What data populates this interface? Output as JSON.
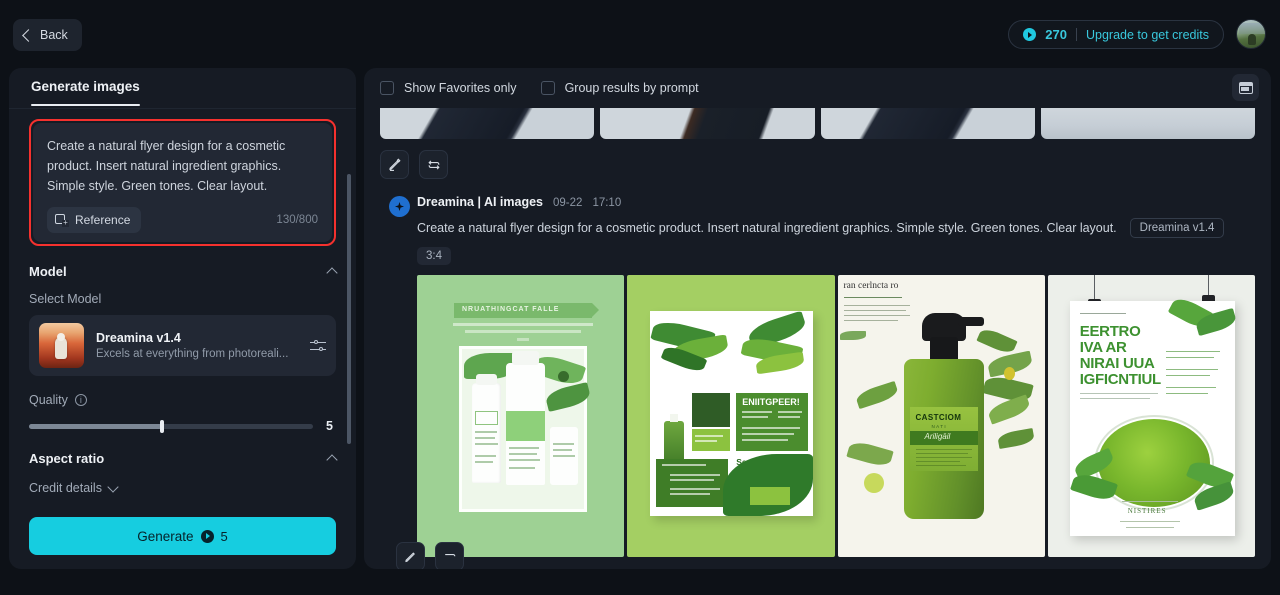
{
  "topbar": {
    "back_label": "Back",
    "credits_value": "270",
    "upgrade_label": "Upgrade to get credits",
    "coin_icon": "credit-coin-icon",
    "avatar_icon": "user-avatar"
  },
  "sidebar": {
    "tab_label": "Generate images",
    "prompt": {
      "text": "Create a natural flyer design for a cosmetic product. Insert natural ingredient graphics. Simple style. Green tones. Clear layout.",
      "reference_label": "Reference",
      "reference_icon": "add-image-icon",
      "char_count": "130/800"
    },
    "model_section": {
      "title": "Model",
      "collapse_icon": "chevron-up-icon",
      "select_label": "Select Model",
      "model_name": "Dreamina v1.4",
      "model_desc": "Excels at everything from photoreali...",
      "settings_icon": "sliders-icon"
    },
    "quality": {
      "label": "Quality",
      "info_icon": "info-icon",
      "value": "5",
      "fill_percent": 47
    },
    "aspect_ratio": {
      "title": "Aspect ratio",
      "collapse_icon": "chevron-up-icon"
    },
    "credit_details": {
      "label": "Credit details",
      "expand_icon": "chevron-down-icon"
    },
    "generate": {
      "label": "Generate",
      "cost": "5",
      "coin_icon": "credit-coin-icon"
    }
  },
  "main": {
    "toolbar": {
      "favorites_label": "Show Favorites only",
      "favorites_checked": false,
      "group_label": "Group results by prompt",
      "group_checked": false,
      "panel_icon": "panel-toggle-icon"
    },
    "previous_actions": {
      "edit_icon": "edit-pencil-icon",
      "regenerate_icon": "regenerate-icon"
    },
    "result": {
      "badge_icon": "dreamina-sparkle-icon",
      "title": "Dreamina | AI images",
      "date": "09-22",
      "time": "17:10",
      "prompt": "Create a natural flyer design for a cosmetic product. Insert natural ingredient graphics. Simple style. Green tones. Clear layout.",
      "model_chip": "Dreamina v1.4",
      "ratio_chip": "3:4",
      "images": [
        {
          "name": "flyer-white-bottles-green-bg",
          "banner_text": "NRUATHINGCAT FALLE",
          "bg_color": "#9ed194"
        },
        {
          "name": "flyer-olive-branches-white-paper",
          "heading_text": "ENIITGPEER!",
          "subheading_text": "Seqq Iraing",
          "bg_color": "#a4cf63"
        },
        {
          "name": "green-pump-bottle-botanical",
          "header_text": "ran cerlncta ro",
          "label_title": "CASTCIOM",
          "label_sub": "NATI",
          "label_script": "Ariligäil",
          "bg_color": "#f5f4ec"
        },
        {
          "name": "hanging-poster-green-powder",
          "headline_line1": "EERTRO",
          "headline_line2": "IVA AR",
          "headline_line3": "NIRAI UUA",
          "headline_line4": "IGFICNTIUL",
          "footer_text": "NISTIRES",
          "bg_color": "#ecefea"
        }
      ]
    }
  }
}
